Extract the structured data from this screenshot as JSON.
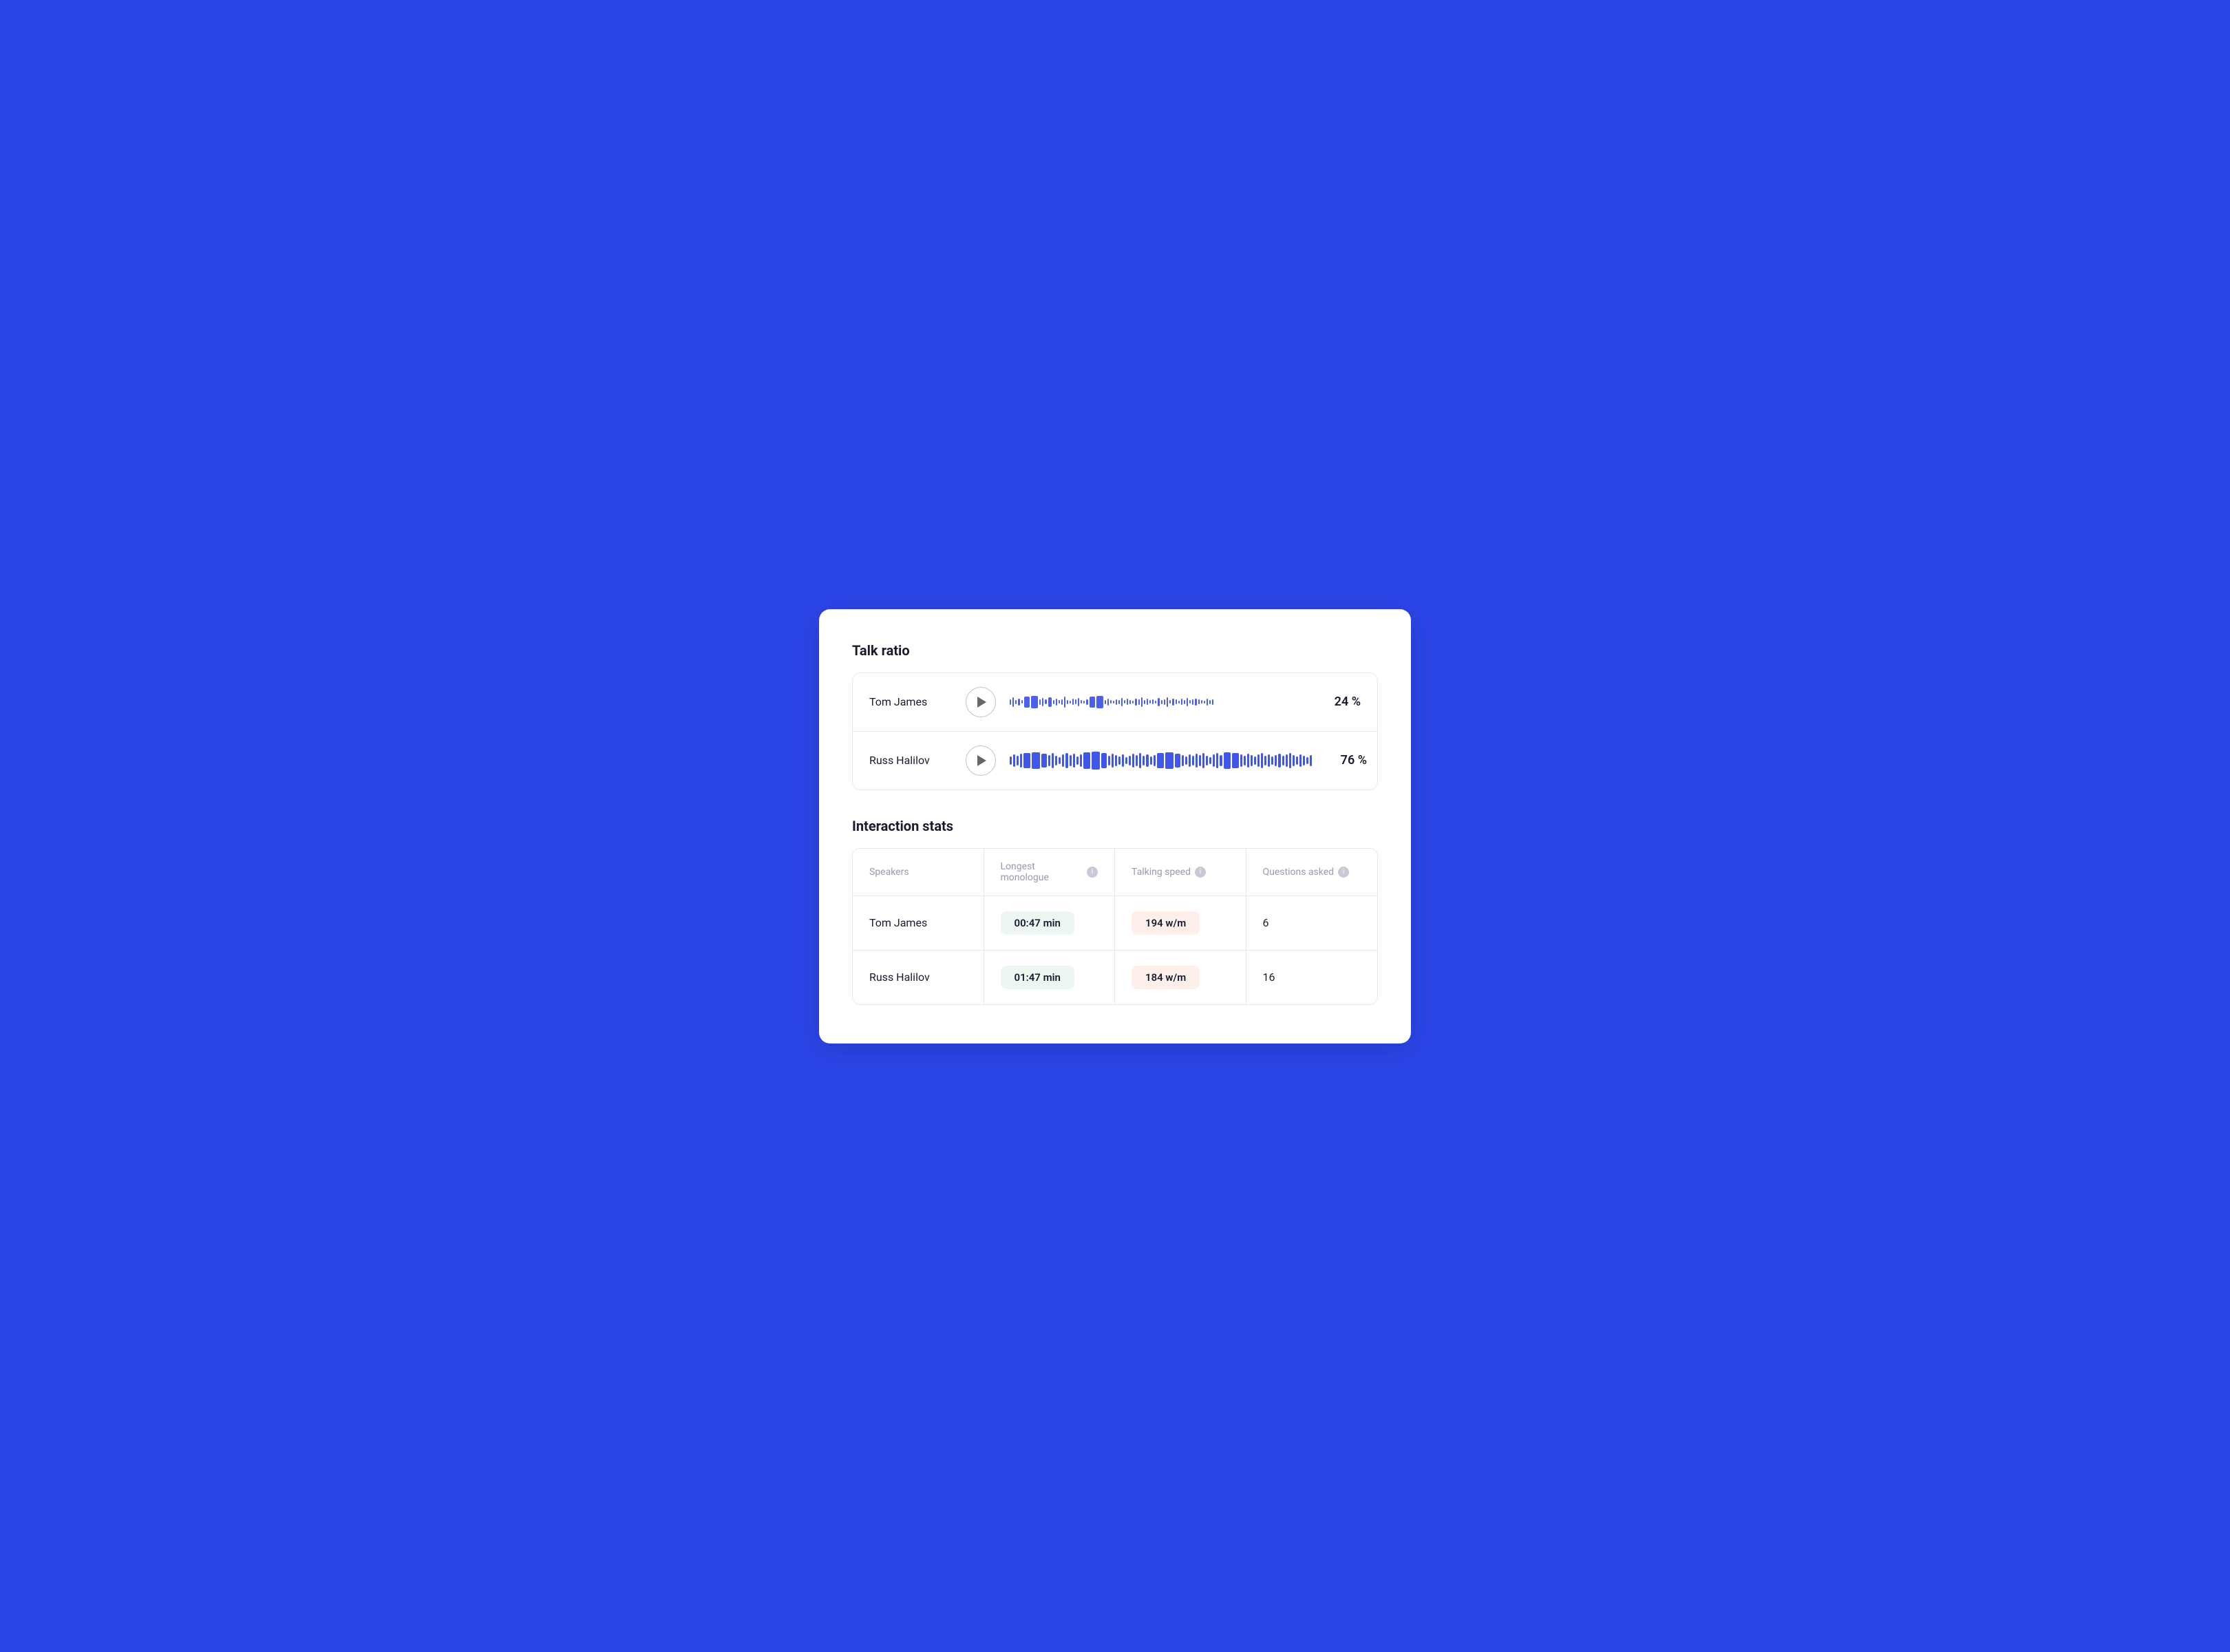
{
  "talk_ratio": {
    "title": "Talk ratio",
    "speakers": [
      {
        "name": "Tom James",
        "percentage": "24 %",
        "play_label": "play"
      },
      {
        "name": "Russ Halilov",
        "percentage": "76 %",
        "play_label": "play"
      }
    ]
  },
  "interaction_stats": {
    "title": "Interaction stats",
    "headers": {
      "speakers": "Speakers",
      "longest_monologue": "Longest monologue",
      "talking_speed": "Talking speed",
      "questions_asked": "Questions asked"
    },
    "rows": [
      {
        "speaker": "Tom James",
        "longest_monologue": "00:47 min",
        "talking_speed": "194 w/m",
        "questions_asked": "6"
      },
      {
        "speaker": "Russ Halilov",
        "longest_monologue": "01:47 min",
        "talking_speed": "184 w/m",
        "questions_asked": "16"
      }
    ]
  }
}
